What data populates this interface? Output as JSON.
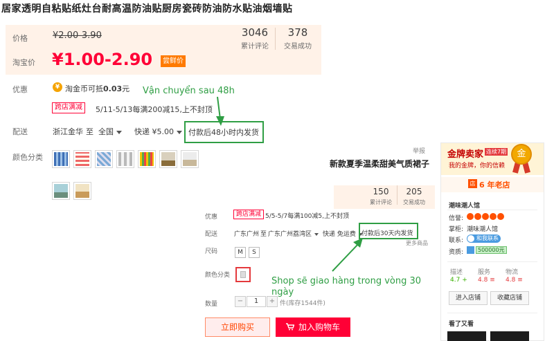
{
  "product_title": "居家透明自粘贴纸灶台耐高温防油贴厨房瓷砖防油防水贴油烟墙贴",
  "panel1": {
    "price_label": "价格",
    "old_price": "¥2.00-3.90",
    "reviews_count": "3046",
    "reviews_label": "累计评论",
    "sales_count": "378",
    "sales_label": "交易成功",
    "taobao_price_label": "淘宝价",
    "new_price": "¥1.00-2.90",
    "badge": "尝鲜价",
    "promo_label": "优惠",
    "coin_text_prefix": "淘金币可抵",
    "coin_amount": "0.03",
    "coin_unit": "元",
    "cross_store_tag": "跨店满减",
    "cross_store_text": "5/11-5/13每满200减15,上不封顶",
    "delivery_label": "配送",
    "origin": "浙江金华",
    "to": "至",
    "destination": "全国",
    "shipping": "快递 ¥5.00",
    "ship_time": "付款后48小时内发货",
    "color_label": "颜色分类"
  },
  "annotation1": "Vận chuyển sau 48h",
  "annotation2": "Shop sẽ giao hàng trong vòng 30 ngày",
  "panel2": {
    "report": "举报",
    "title": "新款夏季温柔甜美气质裙子",
    "reviews_count": "150",
    "reviews_label": "累计评论",
    "sales_count": "205",
    "sales_label": "交易成功",
    "promo_label": "优惠",
    "cross_store_tag": "跨店满减",
    "cross_store_text": "5/5-5/7每满100减5,上不封顶",
    "delivery_label": "配送",
    "origin": "广东广州",
    "to": "至",
    "destination": "广东广州荔湾区",
    "shipping": "快递 免运费",
    "ship_time": "付款后30天内发货",
    "size_label": "尺码",
    "sizes": [
      "M",
      "S"
    ],
    "color_label": "颜色分类",
    "qty_label": "数量",
    "qty_value": "1",
    "stock_text": "件(库存1544件)",
    "minus": "−",
    "plus": "+",
    "buy_now": "立即购买",
    "add_to_cart": "加入购物车",
    "more_label": "更多商品"
  },
  "sidebar": {
    "gold_seller": "金牌卖家",
    "gold_badge": "连续7期",
    "tagline": "我的金牌，你的信赖",
    "medal": "金",
    "old_store_icon": "店",
    "old_store": "6 年老店",
    "shop_name": "潮味潮人馆",
    "credit_label": "信誉:",
    "manager_label": "掌柜:",
    "manager_name": "潮味潮人馆",
    "contact_label": "联系:",
    "contact_btn": "和我联系",
    "deposit_label": "资质:",
    "deposit_value": "500000元",
    "score_labels": [
      "描述",
      "服务",
      "物流"
    ],
    "score_values": [
      "4.7",
      "4.8",
      "4.8"
    ],
    "score_marks": [
      "+",
      "≡",
      "≡"
    ],
    "enter_store": "进入店铺",
    "fav_store": "收藏店铺",
    "seen_label": "看了又看"
  },
  "colors": {
    "price_red": "#ff0036",
    "accent_orange": "#ff7a00",
    "annotation_green": "#2f9e44",
    "price_bg": "#fff2e8"
  }
}
